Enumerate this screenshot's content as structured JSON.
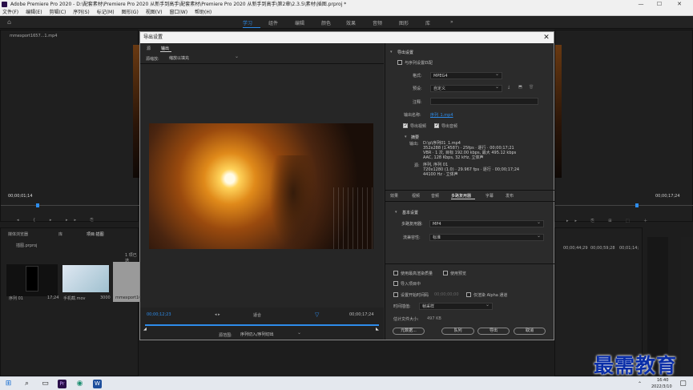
{
  "window": {
    "title": "Adobe Premiere Pro 2020 - D:\\配套素材\\Premiere Pro 2020 从新手到高手\\配套素材\\Premiere Pro 2020 从新手到高手\\第2章\\2.3.5\\素材\\插图.prproj *",
    "minimize": "—",
    "maximize": "☐",
    "close": "✕"
  },
  "menu": [
    "文件(F)",
    "编辑(E)",
    "剪辑(C)",
    "序列(S)",
    "标记(M)",
    "图形(G)",
    "视图(V)",
    "窗口(W)",
    "帮助(H)"
  ],
  "workspaces": {
    "items": [
      "学习",
      "组件",
      "编辑",
      "颜色",
      "效果",
      "音频",
      "图形",
      "库"
    ],
    "more": "»",
    "active_index": 0,
    "accent_color": "#2d8ceb"
  },
  "source_monitor": {
    "tab": "mmexport1657...1.mp4",
    "timecode": "00;00;01;14",
    "right_timecode": "00;00;17;24"
  },
  "project_panel": {
    "tabs": [
      "项目:插图",
      "媒体浏览器",
      "库",
      "信息"
    ],
    "project_name": "插图.prproj",
    "item_count": "1 项已选",
    "items": [
      {
        "name": "序列 01",
        "duration": "17;24"
      },
      {
        "name": "手机截.mov",
        "duration": "3000"
      },
      {
        "name": "mmexport1657...",
        "duration": ""
      }
    ]
  },
  "timeline": {
    "ruler": [
      "00;00;44;29",
      "00;00;59;28",
      "00;01;14;"
    ]
  },
  "export_dialog": {
    "title": "导出设置",
    "left_tabs": [
      "源",
      "输出"
    ],
    "source_scaling_label": "源缩放:",
    "source_scaling_value": "缩放以填充",
    "playhead_time": "00;00;12;23",
    "fit_label": "适合",
    "end_time": "00;00;17;24",
    "range_label": "源范围:",
    "range_value": "序列切入/序列切出",
    "export_settings_header": "导出设置",
    "match_sequence_label": "与序列设置匹配",
    "format_label": "格式:",
    "format_value": "MPEG4",
    "preset_label": "预设:",
    "preset_value": "自定义",
    "comments_label": "注释:",
    "output_name_label": "输出名称:",
    "output_name_value": "序列_1.mp4",
    "export_video_label": "导出视频",
    "export_audio_label": "导出音频",
    "summary_header": "摘要",
    "output_label": "输出:",
    "output_summary": "D:\\p\\序列01_1.mp4\n352x288 (1.4587) · 25fps · 逐行 · 00;00;17;21\nVBR · 1 次, 目标 192.00 kbps, 最大 495.12 kbps\nAAC, 128 Kbps, 32 kHz, 立体声",
    "source_label": "源:",
    "source_summary": "序列, 序列 01\n720x1280 (1.0) · 29.967 fps · 逐行 · 00;00;17;24\n44100 Hz · 立体声",
    "settings_tabs": [
      "效果",
      "视频",
      "音频",
      "多路复用器",
      "字幕",
      "发布"
    ],
    "active_settings_tab": 3,
    "basic_settings_header": "基本设置",
    "multiplexer_label": "多路复用器:",
    "multiplexer_value": "MP4",
    "stream_compat_label": "流兼容性:",
    "stream_compat_value": "标准",
    "max_render_quality": "使用最高渲染质量",
    "use_previews": "使用预览",
    "import_into_project": "导入项目中",
    "set_start_timecode": "设置开始时间码",
    "start_timecode_value": "00;00;00;00",
    "render_alpha": "仅渲染 Alpha 通道",
    "time_interp_label": "时间插值:",
    "time_interp_value": "帧采样",
    "file_size_label": "估计文件大小:",
    "file_size_value": "497 KB",
    "metadata_button": "元数据...",
    "queue_button": "队列",
    "export_button": "导出",
    "cancel_button": "取消"
  },
  "taskbar": {
    "time": "16:40",
    "date": "2022/3/10",
    "lang": "中"
  },
  "watermark": "最需教育"
}
